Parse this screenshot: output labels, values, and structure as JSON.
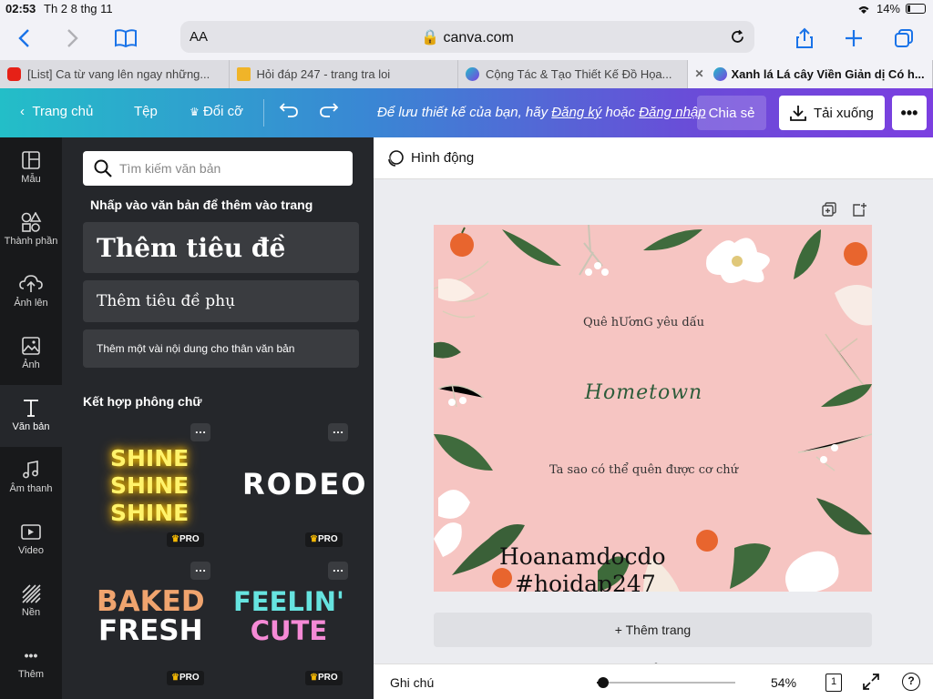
{
  "status": {
    "time": "02:53",
    "date": "Th 2 8 thg 11",
    "battery": "14%"
  },
  "browser": {
    "text_size": "AA",
    "url": "canva.com",
    "tabs": [
      {
        "label": "[List] Ca từ vang lên ngay những...",
        "favicon": "youtube",
        "active": false
      },
      {
        "label": "Hỏi đáp 247 - trang tra loi",
        "favicon": "hoidap",
        "active": false
      },
      {
        "label": "Cộng Tác & Tạo Thiết Kế Đồ Họa...",
        "favicon": "canva",
        "active": false
      },
      {
        "label": "Xanh lá Lá cây Viền Giản dị Có h...",
        "favicon": "canva",
        "active": true
      }
    ]
  },
  "header": {
    "home": "Trang chủ",
    "file": "Tệp",
    "resize": "Đổi cỡ",
    "save_msg_prefix": "Để lưu thiết kế của bạn, hãy",
    "signup": "Đăng ký",
    "or": "hoặc",
    "login": "Đăng nhập",
    "share": "Chia sẻ",
    "download": "Tải xuống"
  },
  "rail": [
    {
      "label": "Mẫu",
      "icon": "template-icon"
    },
    {
      "label": "Thành phần",
      "icon": "elements-icon"
    },
    {
      "label": "Ảnh lên",
      "icon": "upload-icon"
    },
    {
      "label": "Ảnh",
      "icon": "photo-icon"
    },
    {
      "label": "Văn bản",
      "icon": "text-icon"
    },
    {
      "label": "Âm thanh",
      "icon": "music-icon"
    },
    {
      "label": "Video",
      "icon": "video-icon"
    },
    {
      "label": "Nền",
      "icon": "background-icon"
    },
    {
      "label": "Thêm",
      "icon": "more-icon"
    }
  ],
  "panel": {
    "search_placeholder": "Tìm kiếm văn bản",
    "hint": "Nhấp vào văn bản để thêm vào trang",
    "add_title": "Thêm tiêu đề",
    "add_subtitle": "Thêm tiêu đề phụ",
    "add_body": "Thêm một vài nội dung cho thân văn bản",
    "combos_heading": "Kết hợp phông chữ",
    "combos": {
      "shine": [
        "SHINE",
        "SHINE",
        "SHINE"
      ],
      "rodeo": "RODEO",
      "baked": [
        "BAKED",
        "FRESH"
      ],
      "feelin": [
        "FEELIN'",
        "CUTE"
      ],
      "pro": "PRO"
    }
  },
  "workspace": {
    "animate": "Hình động",
    "add_page": "+ Thêm trang",
    "design": {
      "background": "#f6c5c2",
      "line1": "Quê hƯơnG yêu dấu",
      "line2": "Hometown",
      "line3": "Ta sao có thể quên được cơ chứ",
      "line4": "Hoanamdocdo",
      "line5": "#hoidap247"
    }
  },
  "bottom": {
    "notes": "Ghi chú",
    "zoom": "54%",
    "page_count": "1",
    "help": "?"
  }
}
